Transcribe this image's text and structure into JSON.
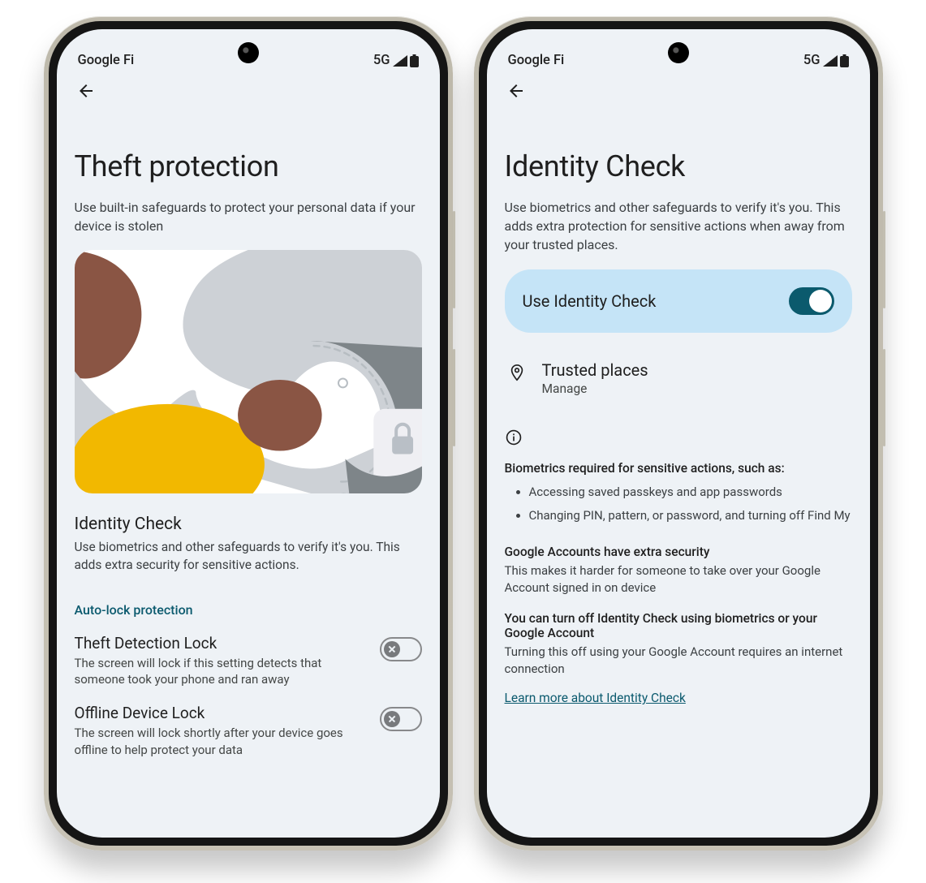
{
  "statusbar": {
    "carrier": "Google Fi",
    "net": "5G"
  },
  "left": {
    "title": "Theft protection",
    "subtitle": "Use built-in safeguards to protect your personal data if your device is stolen",
    "identity": {
      "title": "Identity Check",
      "desc": "Use biometrics and other safeguards to verify it's you. This adds extra security for sensitive actions."
    },
    "section": "Auto-lock protection",
    "theft_lock": {
      "title": "Theft Detection Lock",
      "desc": "The screen will lock if this setting detects that someone took your phone and ran away"
    },
    "offline_lock": {
      "title": "Offline Device Lock",
      "desc": "The screen will lock shortly after your device goes offline to help protect your data"
    }
  },
  "right": {
    "title": "Identity Check",
    "subtitle": "Use biometrics and other safeguards to verify it's you. This adds extra protection for sensitive actions when away from your trusted places.",
    "toggle_label": "Use Identity Check",
    "trusted": {
      "title": "Trusted places",
      "sub": "Manage"
    },
    "info_heading": "Biometrics required for sensitive actions, such as:",
    "bullet1": "Accessing saved passkeys and app passwords",
    "bullet2": "Changing PIN, pattern, or password, and turning off Find My",
    "accounts_h": "Google Accounts have extra security",
    "accounts_t": "This makes it harder for someone to take over your Google Account signed in on device",
    "turnoff_h": "You can turn off Identity Check using biometrics or your Google Account",
    "turnoff_t": "Turning this off using your Google Account requires an internet connection",
    "learn": "Learn more about Identity Check"
  }
}
